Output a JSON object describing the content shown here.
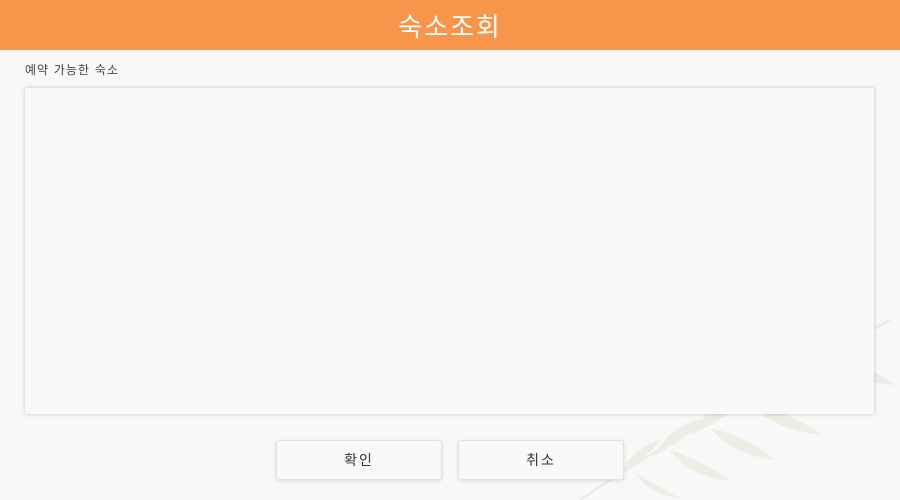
{
  "header": {
    "title": "숙소조회",
    "background_color": "#f7964a"
  },
  "main": {
    "section_label": "예약 가능한 숙소",
    "available_list": {
      "items": []
    }
  },
  "footer": {
    "confirm_label": "확인",
    "cancel_label": "취소"
  },
  "decoration": {
    "icon": "palm-leaf-icon"
  }
}
